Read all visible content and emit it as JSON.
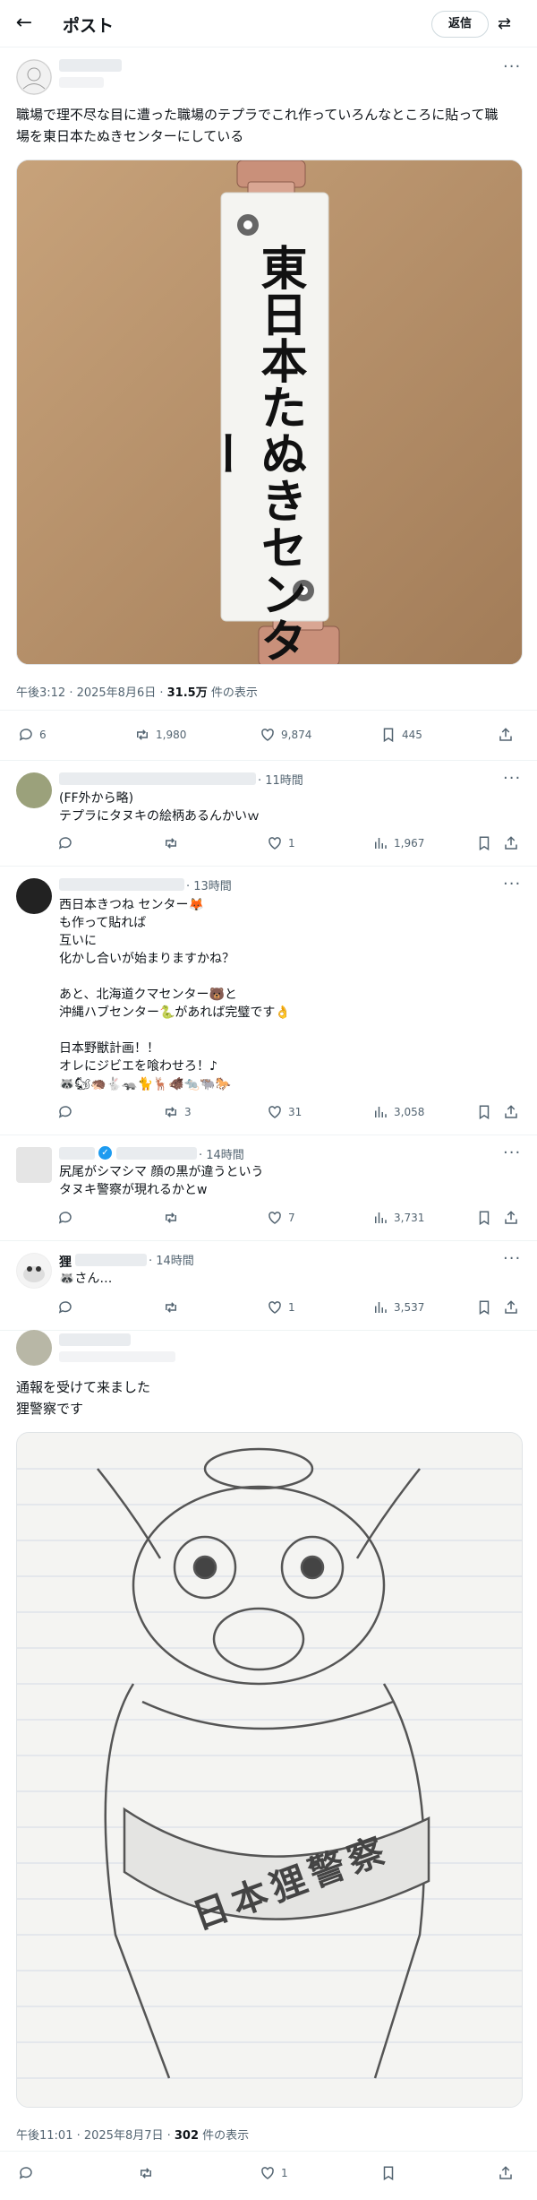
{
  "header": {
    "back_icon": "arrow-left-icon",
    "title": "ポスト",
    "reply_button": "返信",
    "swap_icon": "swap-icon"
  },
  "main_post": {
    "text_line1": "職場で理不尽な目に遭った職場のテプラでこれ作っていろんなところに貼って職",
    "text_line2": "場を東日本たぬきセンターにしている",
    "label_text": "東日本たぬきセンター",
    "time": "午後3:12 · 2025年8月6日 · ",
    "views_count": "31.5万",
    "views_label": " 件の表示",
    "stats": {
      "replies": "6",
      "reposts": "1,980",
      "likes": "9,874",
      "bookmarks": "445"
    }
  },
  "replies": [
    {
      "time": "· 11時間",
      "lines": [
        "(FF外から略)",
        "テプラにタヌキの絵柄あるんかいｗ"
      ],
      "stats": {
        "replies": "",
        "reposts": "",
        "likes": "1",
        "views": "1,967"
      }
    },
    {
      "time": "· 13時間",
      "lines": [
        "西日本きつね センター🦊",
        "も作って貼れば",
        "互いに",
        "化かし合いが始まりますかね？",
        "",
        "あと、北海道クマセンター🐻と",
        "沖縄ハブセンター🐍があれば完璧です👌",
        "",
        "日本野獣計画！！",
        "オレにジビエを喰わせろ！♪",
        "🦝🐿🦔🐇🦡🐈🦌🐗🐀🐃🐎"
      ],
      "stats": {
        "replies": "",
        "reposts": "3",
        "likes": "31",
        "views": "3,058"
      }
    },
    {
      "time": "· 14時間",
      "lines": [
        "尻尾がシマシマ 顔の黒が違うという",
        "タヌキ警察が現れるかとw"
      ],
      "stats": {
        "replies": "",
        "reposts": "",
        "likes": "7",
        "views": "3,731"
      }
    },
    {
      "name_prefix": "狸",
      "time": "· 14時間",
      "lines": [
        "🦝さん…"
      ],
      "stats": {
        "replies": "",
        "reposts": "",
        "likes": "1",
        "views": "3,537"
      }
    }
  ],
  "last_post": {
    "lines": [
      "通報を受けて来ました",
      "狸警察です"
    ],
    "sash_text": "日本狸警察",
    "time": "午後11:01 · 2025年8月7日 · ",
    "views_count": "302",
    "views_label": " 件の表示",
    "stats": {
      "replies": "",
      "reposts": "",
      "likes": "1",
      "bookmarks": ""
    }
  }
}
